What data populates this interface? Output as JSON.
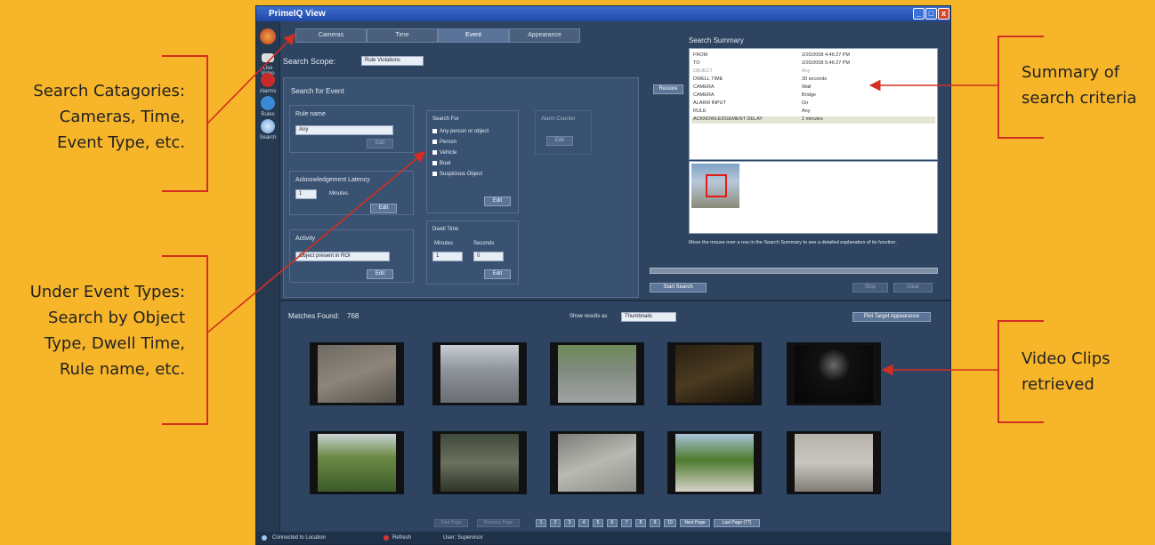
{
  "annotations": {
    "categories": [
      "Search Catagories:",
      "Cameras, Time,",
      "Event Type, etc."
    ],
    "event_types": [
      "Under Event Types:",
      "Search by Object",
      "Type, Dwell Time,",
      "Rule name, etc."
    ],
    "summary": [
      "Summary of",
      "search criteria"
    ],
    "clips": [
      "Video Clips",
      "retrieved"
    ]
  },
  "colors": {
    "background": "#f7b52a",
    "annotation_line": "#d32f20",
    "window": "#2f4460"
  },
  "window": {
    "title": "PrimeIQ View",
    "controls": [
      "_",
      "□",
      "x"
    ]
  },
  "leftbar": {
    "items": [
      {
        "label": "Live Video",
        "icon": "camera-icon"
      },
      {
        "label": "Alarms",
        "icon": "alarm-icon"
      },
      {
        "label": "Rules",
        "icon": "rules-icon"
      },
      {
        "label": "Search",
        "icon": "search-icon"
      }
    ]
  },
  "tabs": [
    "Cameras",
    "Time",
    "Event",
    "Appearance"
  ],
  "search_scope": {
    "label": "Search Scope:",
    "value": "Rule Violations"
  },
  "event_panel": {
    "title": "Search for Event",
    "rule_name_label": "Rule name",
    "rule_name_value": "Any",
    "ack_latency_label": "Acknowledgement Latency",
    "ack_value": "1",
    "ack_unit": "Minutes",
    "activity_label": "Activity",
    "activity_value": "Object present in ROI",
    "search_for_label": "Search For",
    "search_for_options": [
      "Any person or object",
      "Person",
      "Vehicle",
      "Boat",
      "Suspicious Object"
    ],
    "alarm_counter_label": "Alarm Counter",
    "dwell_time_label": "Dwell Time",
    "minutes_label": "Minutes",
    "seconds_label": "Seconds",
    "minutes_value": "1",
    "seconds_value": "0",
    "edit_label": "Edit"
  },
  "summary": {
    "title": "Search Summary",
    "restore_label": "Restore",
    "rows": [
      {
        "k": "FROM",
        "v": "2/20/2008 4:46:27 PM"
      },
      {
        "k": "TO",
        "v": "2/20/2008 5:46:27 PM"
      },
      {
        "k": "OBJECT",
        "v": "Any"
      },
      {
        "k": "DWELL TIME",
        "v": "30 seconds"
      },
      {
        "k": "CAMERA",
        "v": "Wall"
      },
      {
        "k": "CAMERA",
        "v": "Bridge"
      },
      {
        "k": "ALARM INPUT",
        "v": "On"
      },
      {
        "k": "RULE",
        "v": "Any"
      },
      {
        "k": "ACKNOWLEDGEMENT DELAY",
        "v": "2 minutes"
      }
    ],
    "hint": "Move the mouse over a row in the Search Summary to see a detailed explanation of its function.",
    "start_search": "Start Search",
    "stop_label": "Stop",
    "clear_label": "Clear"
  },
  "results": {
    "matches_label": "Matches Found:",
    "matches_count": "768",
    "show_results_label": "Show results as",
    "show_results_value": "Thumbnails",
    "plot_button": "Plot Target Appearance",
    "pager": [
      "First Page",
      "Previous Page",
      "1",
      "2",
      "3",
      "4",
      "5",
      "6",
      "7",
      "8",
      "9",
      "10",
      "Next Page",
      "Last Page (77)"
    ]
  },
  "statusbar": {
    "connection": "Connected to Location",
    "refresh": "Refresh",
    "user": "User: Supervisor"
  }
}
